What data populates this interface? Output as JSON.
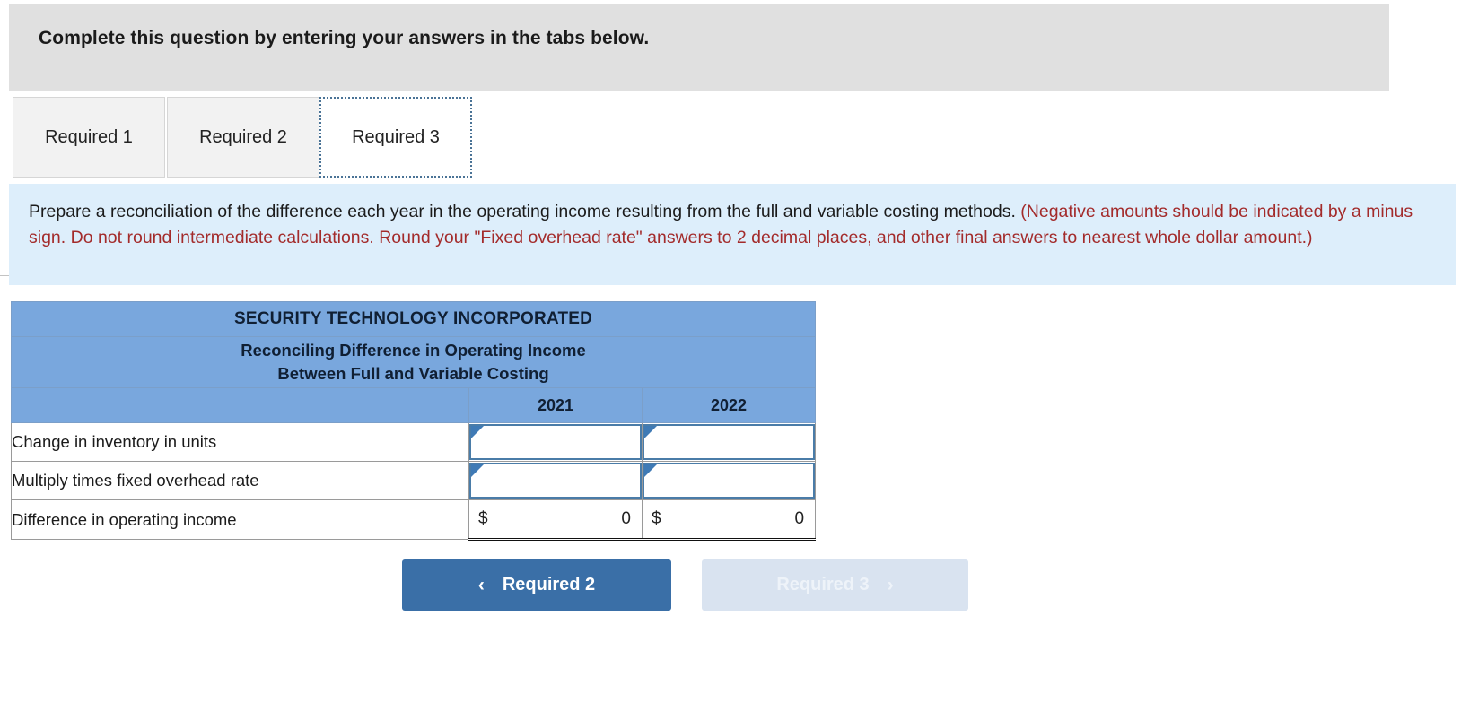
{
  "banner": {
    "title": "Complete this question by entering your answers in the tabs below."
  },
  "tabs": [
    {
      "label": "Required 1",
      "active": false
    },
    {
      "label": "Required 2",
      "active": false
    },
    {
      "label": "Required 3",
      "active": true
    }
  ],
  "instructions": {
    "main": "Prepare a reconciliation of the difference each year in the operating income resulting from the full and variable costing methods. ",
    "note": "(Negative amounts should be indicated by a minus sign. Do not round intermediate calculations. Round your \"Fixed overhead rate\" answers to 2 decimal places, and other final answers to nearest whole dollar amount.)"
  },
  "sheet": {
    "company": "SECURITY TECHNOLOGY INCORPORATED",
    "subtitle_line1": "Reconciling Difference in Operating Income",
    "subtitle_line2": "Between Full and Variable Costing",
    "year_headers": [
      "2021",
      "2022"
    ],
    "rows": [
      {
        "label": "Change in inventory in units",
        "type": "input",
        "values": [
          "",
          ""
        ],
        "markers": [
          "dropdown-marker",
          "dropdown-marker"
        ]
      },
      {
        "label": "Multiply times fixed overhead rate",
        "type": "input",
        "values": [
          "",
          ""
        ],
        "markers": [
          "dropdown-marker",
          "dropdown-marker"
        ]
      },
      {
        "label": "Difference in operating income",
        "type": "total",
        "currency": [
          "$",
          "$"
        ],
        "values": [
          "0",
          "0"
        ]
      }
    ]
  },
  "nav": {
    "prev": {
      "label": "Required 2",
      "icon": "chevron-left",
      "glyph": "‹",
      "enabled": true
    },
    "next": {
      "label": "Required 3",
      "icon": "chevron-right",
      "glyph": "›",
      "enabled": false
    }
  },
  "colors": {
    "banner_bg": "#e0e0e0",
    "instruction_bg": "#ddeefb",
    "note_text": "#a32b2b",
    "table_header_bg": "#79a7dd",
    "primary_button": "#3a6fa7",
    "disabled_button": "#d9e3f0",
    "input_border": "#4a7ca8"
  }
}
